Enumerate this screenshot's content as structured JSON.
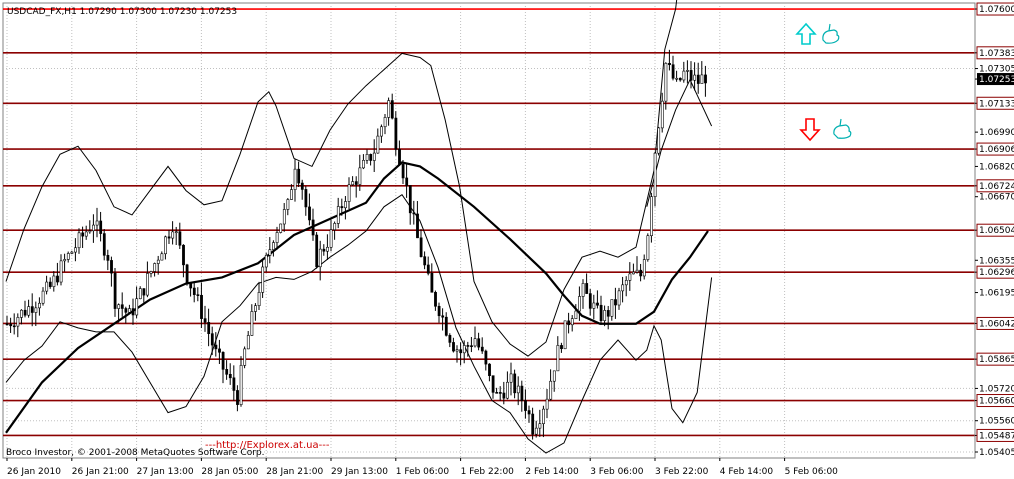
{
  "header": {
    "symbol_line": "USDCAD_FX,H1  1.07290 1.07300 1.07230 1.07253"
  },
  "footer": {
    "copyright": "Broco Investor, © 2001-2008 MetaQuotes Software Corp."
  },
  "watermark": {
    "text": "---http://Explorex.at.ua---"
  },
  "colors": {
    "background": "#ffffff",
    "grid": "#c0c0c0",
    "candle": "#000000",
    "bollinger": "#000000",
    "moving_average": "#000000",
    "level_line": "#8b0000",
    "top_level_line": "#ff0000",
    "current_price_bg": "#000000",
    "up_arrow": "#00cccc",
    "down_arrow": "#ff0000",
    "watermark": "#cc0000"
  },
  "chart_data": {
    "type": "candlestick",
    "symbol": "USDCAD_FX",
    "timeframe": "H1",
    "ohlc_header": {
      "open": 1.0729,
      "high": 1.073,
      "low": 1.0723,
      "close": 1.07253
    },
    "ylim": [
      1.054,
      1.0761
    ],
    "y_ticks": [
      "1.07600",
      "1.07383",
      "1.07305",
      "1.07253",
      "1.07133",
      "1.06990",
      "1.06906",
      "1.06820",
      "1.06724",
      "1.06670",
      "1.06504",
      "1.06355",
      "1.06296",
      "1.06195",
      "1.06042",
      "1.05865",
      "1.05720",
      "1.05660",
      "1.05560",
      "1.05487",
      "1.05405"
    ],
    "x_ticks": [
      "26 Jan 2010",
      "26 Jan 21:00",
      "27 Jan 13:00",
      "28 Jan 05:00",
      "28 Jan 21:00",
      "29 Jan 13:00",
      "1 Feb 06:00",
      "1 Feb 22:00",
      "2 Feb 14:00",
      "3 Feb 06:00",
      "3 Feb 22:00",
      "4 Feb 14:00",
      "5 Feb 06:00"
    ],
    "grid": true,
    "current_price": 1.07253,
    "horizontal_levels": [
      1.076,
      1.07383,
      1.07133,
      1.06906,
      1.06724,
      1.06504,
      1.06296,
      1.06042,
      1.05865,
      1.0566,
      1.05487
    ],
    "close_path": [
      [
        0,
        1.0604
      ],
      [
        6,
        1.0612
      ],
      [
        12,
        1.0622
      ],
      [
        16,
        1.0635
      ],
      [
        20,
        1.0645
      ],
      [
        24,
        1.0655
      ],
      [
        28,
        1.0638
      ],
      [
        30,
        1.0616
      ],
      [
        34,
        1.0608
      ],
      [
        38,
        1.0622
      ],
      [
        42,
        1.0638
      ],
      [
        46,
        1.0654
      ],
      [
        50,
        1.0628
      ],
      [
        54,
        1.061
      ],
      [
        58,
        1.0589
      ],
      [
        62,
        1.0575
      ],
      [
        64,
        1.0568
      ],
      [
        66,
        1.059
      ],
      [
        70,
        1.0622
      ],
      [
        74,
        1.0648
      ],
      [
        78,
        1.0662
      ],
      [
        80,
        1.0684
      ],
      [
        82,
        1.0672
      ],
      [
        84,
        1.0652
      ],
      [
        86,
        1.0636
      ],
      [
        90,
        1.0648
      ],
      [
        94,
        1.0668
      ],
      [
        98,
        1.0679
      ],
      [
        102,
        1.069
      ],
      [
        104,
        1.0702
      ],
      [
        106,
        1.0714
      ],
      [
        108,
        1.0695
      ],
      [
        110,
        1.068
      ],
      [
        112,
        1.0662
      ],
      [
        114,
        1.0646
      ],
      [
        116,
        1.0632
      ],
      [
        118,
        1.0618
      ],
      [
        120,
        1.0612
      ],
      [
        122,
        1.0602
      ],
      [
        124,
        1.0594
      ],
      [
        126,
        1.059
      ],
      [
        130,
        1.0597
      ],
      [
        132,
        1.0588
      ],
      [
        134,
        1.0576
      ],
      [
        136,
        1.0568
      ],
      [
        140,
        1.0575
      ],
      [
        144,
        1.0564
      ],
      [
        146,
        1.0553
      ],
      [
        148,
        1.0559
      ],
      [
        150,
        1.0569
      ],
      [
        152,
        1.0584
      ],
      [
        154,
        1.0596
      ],
      [
        156,
        1.0606
      ],
      [
        158,
        1.0614
      ],
      [
        160,
        1.062
      ],
      [
        162,
        1.0615
      ],
      [
        164,
        1.0609
      ],
      [
        166,
        1.0608
      ],
      [
        168,
        1.0612
      ],
      [
        170,
        1.0618
      ],
      [
        172,
        1.0625
      ],
      [
        174,
        1.0628
      ],
      [
        176,
        1.0628
      ],
      [
        178,
        1.065
      ],
      [
        180,
        1.069
      ],
      [
        182,
        1.0718
      ],
      [
        183,
        1.0733
      ],
      [
        186,
        1.0722
      ],
      [
        188,
        1.0728
      ],
      [
        192,
        1.0724
      ],
      [
        194,
        1.0727
      ]
    ],
    "moving_average": [
      [
        0,
        1.055
      ],
      [
        10,
        1.0575
      ],
      [
        20,
        1.0592
      ],
      [
        30,
        1.0604
      ],
      [
        40,
        1.0616
      ],
      [
        50,
        1.0624
      ],
      [
        60,
        1.0627
      ],
      [
        70,
        1.0634
      ],
      [
        80,
        1.0648
      ],
      [
        90,
        1.0656
      ],
      [
        100,
        1.0664
      ],
      [
        105,
        1.0676
      ],
      [
        110,
        1.0684
      ],
      [
        115,
        1.0682
      ],
      [
        120,
        1.0676
      ],
      [
        130,
        1.0662
      ],
      [
        140,
        1.0646
      ],
      [
        150,
        1.0629
      ],
      [
        155,
        1.0618
      ],
      [
        160,
        1.0608
      ],
      [
        165,
        1.0604
      ],
      [
        170,
        1.0604
      ],
      [
        175,
        1.0604
      ],
      [
        180,
        1.061
      ],
      [
        185,
        1.0626
      ],
      [
        190,
        1.0637
      ],
      [
        195,
        1.065
      ]
    ],
    "bollinger_upper": [
      [
        0,
        1.0625
      ],
      [
        5,
        1.0651
      ],
      [
        10,
        1.0672
      ],
      [
        15,
        1.0688
      ],
      [
        20,
        1.0692
      ],
      [
        25,
        1.068
      ],
      [
        30,
        1.0662
      ],
      [
        35,
        1.0658
      ],
      [
        40,
        1.067
      ],
      [
        45,
        1.0682
      ],
      [
        50,
        1.067
      ],
      [
        55,
        1.0663
      ],
      [
        60,
        1.0665
      ],
      [
        65,
        1.0688
      ],
      [
        70,
        1.0714
      ],
      [
        73,
        1.0719
      ],
      [
        75,
        1.0712
      ],
      [
        80,
        1.0686
      ],
      [
        85,
        1.0682
      ],
      [
        90,
        1.07
      ],
      [
        95,
        1.0713
      ],
      [
        100,
        1.0722
      ],
      [
        105,
        1.073
      ],
      [
        110,
        1.0738
      ],
      [
        115,
        1.0736
      ],
      [
        118,
        1.0732
      ],
      [
        122,
        1.0705
      ],
      [
        126,
        1.0672
      ],
      [
        130,
        1.0625
      ],
      [
        135,
        1.0605
      ],
      [
        140,
        1.0594
      ],
      [
        145,
        1.0588
      ],
      [
        150,
        1.0595
      ],
      [
        155,
        1.0621
      ],
      [
        160,
        1.0637
      ],
      [
        165,
        1.064
      ],
      [
        170,
        1.0637
      ],
      [
        175,
        1.0642
      ],
      [
        180,
        1.068
      ],
      [
        183,
        1.074
      ],
      [
        186,
        1.076
      ],
      [
        188,
        1.079
      ]
    ],
    "bollinger_lower": [
      [
        0,
        1.0575
      ],
      [
        5,
        1.0586
      ],
      [
        10,
        1.0593
      ],
      [
        15,
        1.0605
      ],
      [
        20,
        1.0602
      ],
      [
        25,
        1.06
      ],
      [
        30,
        1.06
      ],
      [
        35,
        1.059
      ],
      [
        40,
        1.0575
      ],
      [
        45,
        1.056
      ],
      [
        50,
        1.0563
      ],
      [
        55,
        1.0578
      ],
      [
        60,
        1.0605
      ],
      [
        65,
        1.0613
      ],
      [
        70,
        1.0624
      ],
      [
        75,
        1.0627
      ],
      [
        80,
        1.0626
      ],
      [
        85,
        1.063
      ],
      [
        90,
        1.0637
      ],
      [
        95,
        1.0643
      ],
      [
        100,
        1.065
      ],
      [
        105,
        1.0662
      ],
      [
        110,
        1.0668
      ],
      [
        115,
        1.0655
      ],
      [
        120,
        1.0632
      ],
      [
        125,
        1.0602
      ],
      [
        130,
        1.0583
      ],
      [
        135,
        1.0566
      ],
      [
        140,
        1.056
      ],
      [
        145,
        1.0547
      ],
      [
        150,
        1.054
      ],
      [
        155,
        1.0545
      ],
      [
        160,
        1.0566
      ],
      [
        165,
        1.0586
      ],
      [
        170,
        1.0596
      ],
      [
        175,
        1.0586
      ],
      [
        178,
        1.0591
      ],
      [
        180,
        1.0603
      ],
      [
        182,
        1.0596
      ],
      [
        185,
        1.0562
      ],
      [
        188,
        1.0555
      ],
      [
        192,
        1.057
      ],
      [
        196,
        1.0627
      ]
    ],
    "bollinger_upper_inner": [
      [
        178,
        1.0662
      ],
      [
        182,
        1.069
      ],
      [
        186,
        1.071
      ],
      [
        190,
        1.0725
      ],
      [
        196,
        1.0702
      ]
    ]
  }
}
